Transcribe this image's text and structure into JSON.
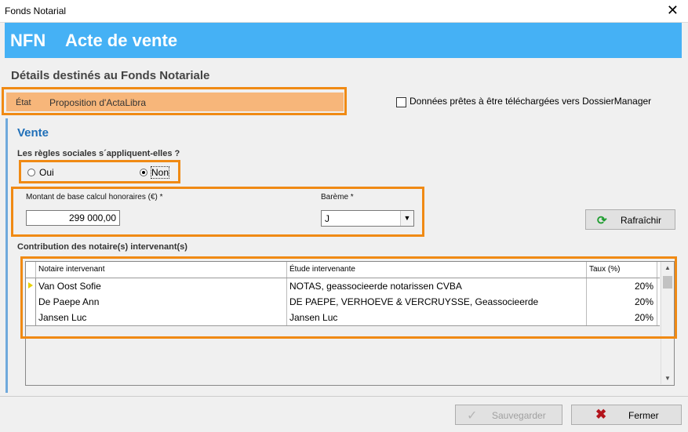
{
  "window": {
    "title": "Fonds Notarial",
    "close_glyph": "✕"
  },
  "header": {
    "prefix": "NFN",
    "title": "Acte de vente",
    "bg_color": "#45b1f5"
  },
  "section_title": "Détails destinés au Fonds Notariale",
  "state": {
    "label": "État",
    "value": "Proposition d'ActaLibra"
  },
  "checkbox": {
    "label": "Données prêtes à être téléchargées vers DossierManager",
    "checked": false
  },
  "vente": {
    "title": "Vente",
    "question": "Les règles sociales s´appliquent-elles ?",
    "options": [
      {
        "label": "Oui",
        "selected": false
      },
      {
        "label": "Non",
        "selected": true
      }
    ],
    "montant_label": "Montant de base calcul honoraires (€) *",
    "montant_value": "299 000,00",
    "bareme_label": "Barème *",
    "bareme_value": "J",
    "refresh_label": "Rafraîchir"
  },
  "contrib": {
    "label": "Contribution des notaire(s) intervenant(s)",
    "columns": [
      "Notaire intervenant",
      "Étude intervenante",
      "Taux (%)"
    ],
    "rows": [
      {
        "notaire": "Van Oost Sofie",
        "etude": "NOTAS, geassocieerde notarissen CVBA",
        "taux": "20%"
      },
      {
        "notaire": "De Paepe Ann",
        "etude": "DE PAEPE, VERHOEVE & VERCRUYSSE, Geassocieerde",
        "taux": "20%"
      },
      {
        "notaire": "Jansen Luc",
        "etude": "Jansen Luc",
        "taux": "20%"
      }
    ]
  },
  "buttons": {
    "save": "Sauvegarder",
    "close": "Fermer"
  },
  "colors": {
    "highlight": "#f08a14",
    "state_bg": "#f7b67a",
    "vente_title": "#1f6fb8"
  }
}
